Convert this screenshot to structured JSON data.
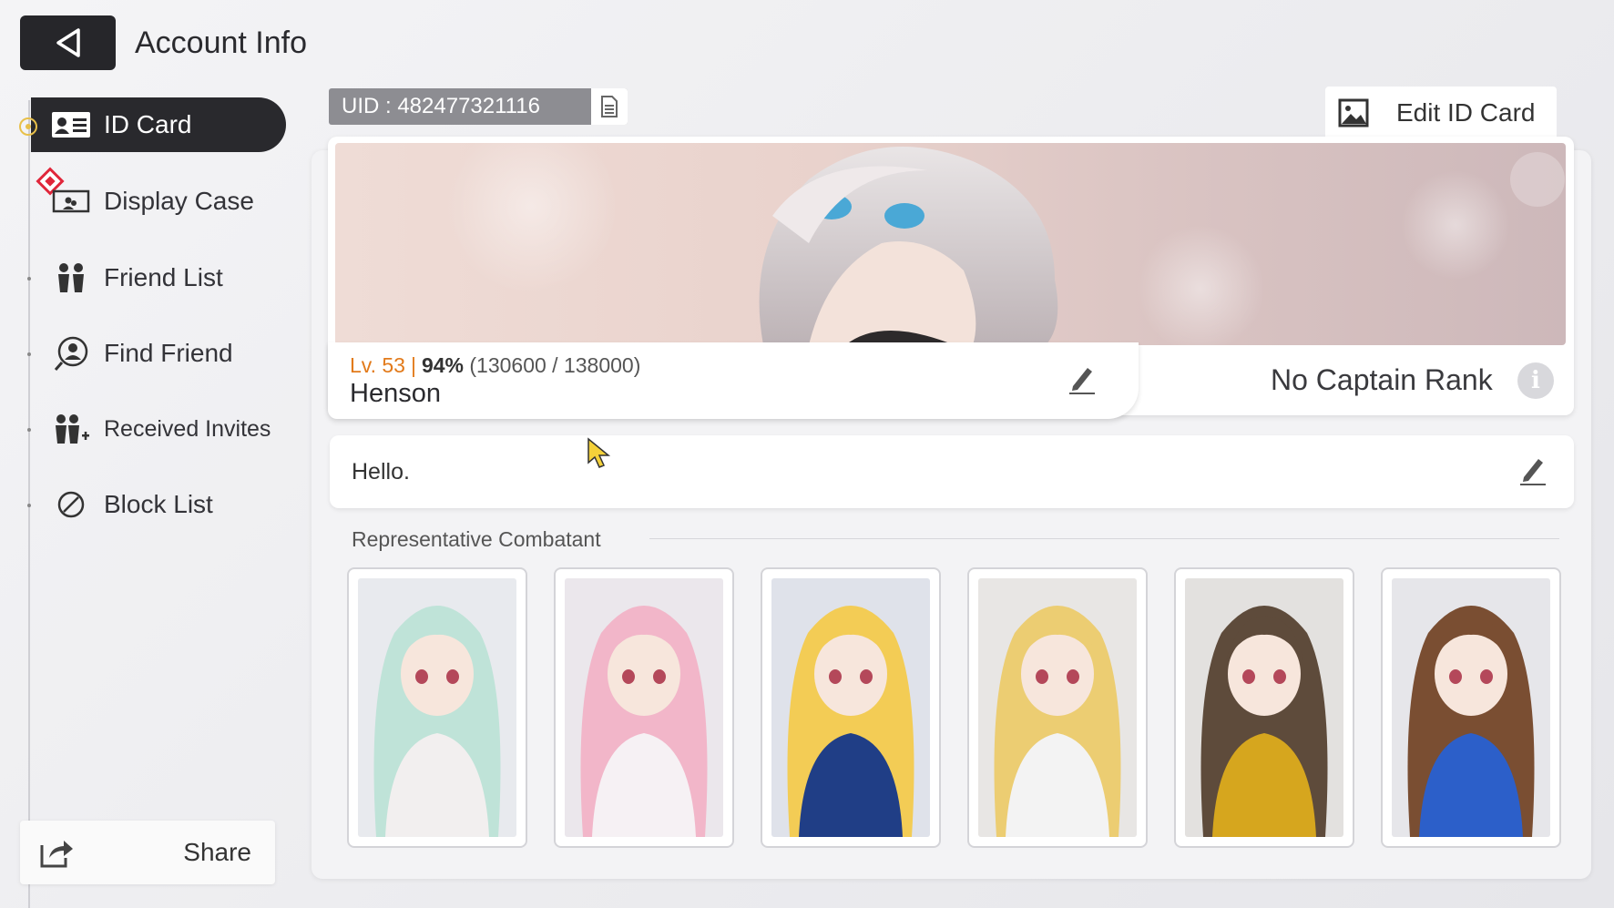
{
  "header": {
    "title": "Account Info",
    "back_icon": "back-triangle-icon"
  },
  "sidebar": {
    "items": [
      {
        "label": "ID Card",
        "icon": "id-card-icon",
        "active": true
      },
      {
        "label": "Display Case",
        "icon": "display-case-icon",
        "active": false,
        "badge": "red-diamond"
      },
      {
        "label": "Friend List",
        "icon": "friends-icon",
        "active": false
      },
      {
        "label": "Find Friend",
        "icon": "search-user-icon",
        "active": false
      },
      {
        "label": "Received Invites",
        "icon": "invite-icon",
        "active": false
      },
      {
        "label": "Block List",
        "icon": "block-icon",
        "active": false
      }
    ],
    "share_label": "Share"
  },
  "uid": {
    "text": "UID : 482477321116"
  },
  "edit_id_card": {
    "label": "Edit ID Card"
  },
  "profile": {
    "level": "Lv. 53",
    "exp_percent": "94%",
    "exp_detail": "(130600 / 138000)",
    "exp_fraction": 0.946,
    "name": "Henson",
    "captain_rank": "No Captain Rank",
    "info_symbol": "i"
  },
  "greeting": {
    "text": "Hello."
  },
  "section": {
    "representative_title": "Representative Combatant"
  },
  "combatants": [
    {
      "hair": "#bfe3d8",
      "outfit": "#f2efef",
      "bg": "#e8eaee"
    },
    {
      "hair": "#f2b6c9",
      "outfit": "#f6f1f4",
      "bg": "#ebe7ec"
    },
    {
      "hair": "#f3cc55",
      "outfit": "#203e86",
      "bg": "#dfe2ea"
    },
    {
      "hair": "#eccd72",
      "outfit": "#f3f3f3",
      "bg": "#e8e6e4"
    },
    {
      "hair": "#5e4b3b",
      "outfit": "#d6a61e",
      "bg": "#e3e1df"
    },
    {
      "hair": "#7a4e32",
      "outfit": "#2c5fc9",
      "bg": "#e6e6ea"
    }
  ],
  "colors": {
    "accent_level": "#e27a1a",
    "dark": "#29292d",
    "badge_red": "#e0263a"
  }
}
